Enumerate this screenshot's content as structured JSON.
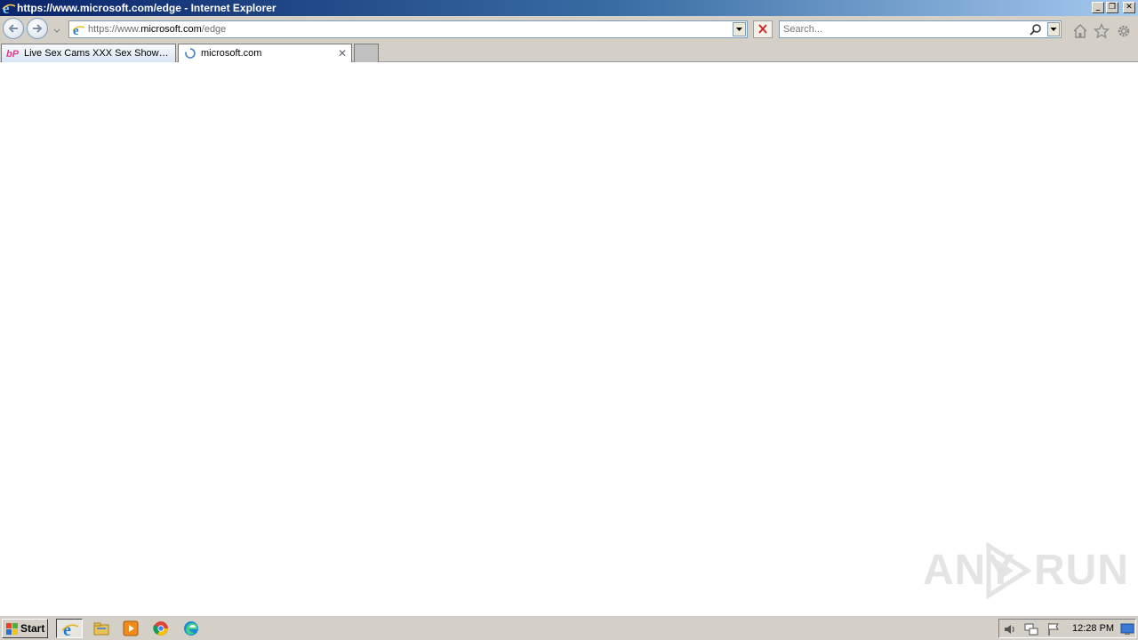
{
  "window": {
    "title": "https://www.microsoft.com/edge - Internet Explorer"
  },
  "address_bar": {
    "url_prefix": "https://www.",
    "url_host": "microsoft.com",
    "url_suffix": "/edge"
  },
  "search": {
    "placeholder": "Search..."
  },
  "tabs": [
    {
      "label": "Live Sex Cams XXX Sex Shows, ...",
      "active": false
    },
    {
      "label": "microsoft.com",
      "active": true,
      "loading": true
    }
  ],
  "watermark": {
    "left_text": "ANY",
    "right_text": "RUN"
  },
  "taskbar": {
    "start_label": "Start",
    "clock": "12:28 PM"
  },
  "icons": {
    "browser": "internet-explorer-icon",
    "back": "back-arrow-icon",
    "forward": "forward-arrow-icon",
    "stop": "close-icon",
    "search": "search-icon",
    "home": "home-icon",
    "favorites": "star-icon",
    "tools": "gear-icon"
  },
  "colors": {
    "title_bar_start": "#0a246a",
    "title_bar_end": "#a6caf0",
    "chrome_gray": "#d4d0c8",
    "stop_red": "#cc2222"
  }
}
